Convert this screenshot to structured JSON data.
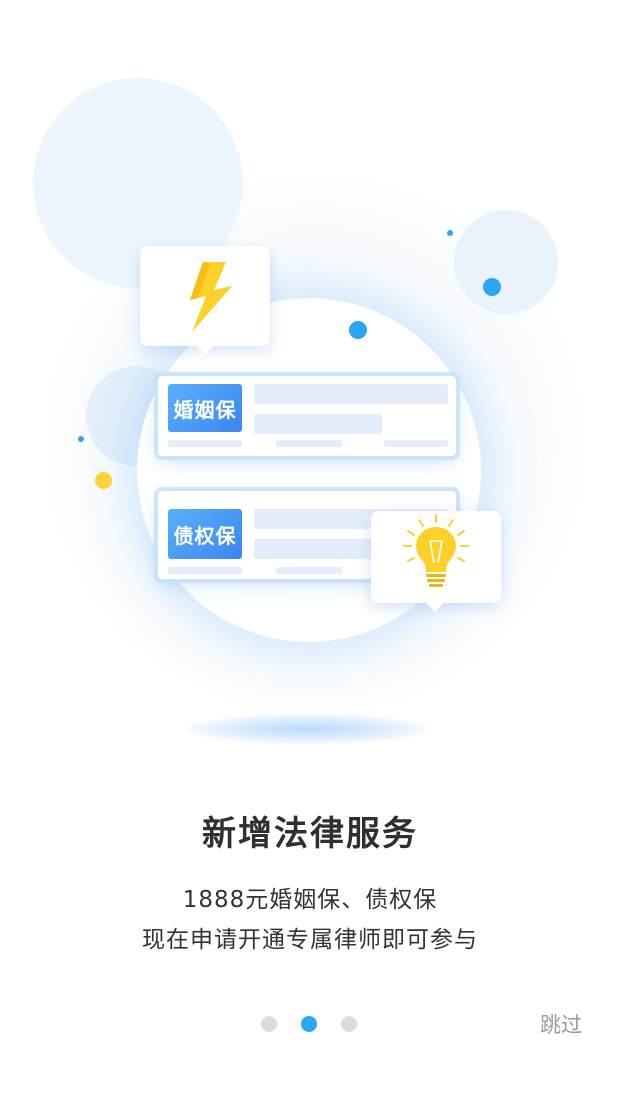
{
  "illustration": {
    "card_1_tag": "婚姻保",
    "card_2_tag": "债权保",
    "icons": [
      "lightning-bolt-icon",
      "light-bulb-icon"
    ],
    "colors": {
      "accent_blue": "#2ea4f4",
      "tag_blue": "#3a86ef",
      "bolt_yellow": "#fcd22a",
      "bubble_blue": "#eef6fd"
    }
  },
  "content": {
    "title": "新增法律服务",
    "line_1": "1888元婚姻保、债权保",
    "line_2": "现在申请开通专属律师即可参与"
  },
  "pagination": {
    "total": 3,
    "active_index": 2
  },
  "actions": {
    "skip_label": "跳过"
  }
}
